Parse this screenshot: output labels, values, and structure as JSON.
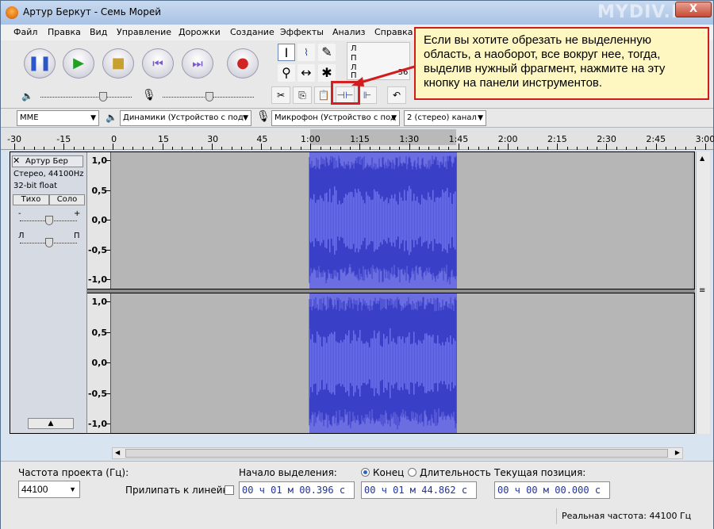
{
  "window": {
    "title": "Артур Беркут - Семь Морей",
    "watermark": "MYDIV.NET",
    "close_glyph": "X"
  },
  "menu": [
    "Файл",
    "Правка",
    "Вид",
    "Управление",
    "Дорожки",
    "Создание",
    "Эффекты",
    "Анализ",
    "Справка"
  ],
  "transport": {
    "pause": "pause-icon",
    "play": "play-icon",
    "stop": "stop-icon",
    "skip_start": "skip-start-icon",
    "skip_end": "skip-end-icon",
    "record": "record-icon"
  },
  "meters": {
    "left_label": "Л",
    "right_label": "П",
    "left_label_2": "Л",
    "right_label_2": "П",
    "db_value": "-36"
  },
  "callout": {
    "text": "Если вы хотите обрезать не выделенную область, а наоборот, все вокруг нее, тогда, выделив нужный фрагмент, нажмите на эту кнопку на панели инструментов."
  },
  "devices": {
    "host": "MME",
    "output": "Динамики (Устройство с под",
    "input": "Микрофон (Устройство с под",
    "channels": "2 (стерео) канал"
  },
  "ruler": {
    "labels": [
      "-30",
      "-15",
      "0",
      "15",
      "30",
      "45",
      "1:00",
      "1:15",
      "1:30",
      "1:45",
      "2:00",
      "2:15",
      "2:30",
      "2:45",
      "3:00"
    ]
  },
  "track": {
    "name": "Артур Бер",
    "info_rate": "Стерео, 44100Hz",
    "info_format": "32-bit float",
    "mute": "Тихо",
    "solo": "Соло",
    "gain_minus": "-",
    "gain_plus": "+",
    "pan_left": "Л",
    "pan_right": "П",
    "scale": [
      "1,0",
      "0,5",
      "0,0",
      "-0,5",
      "-1,0"
    ]
  },
  "bottom": {
    "rate_label": "Частота проекта (Гц):",
    "rate_value": "44100",
    "snap_label": "Прилипать к линейке",
    "sel_start_label": "Начало выделения:",
    "sel_start_value": "00 ч 01 м 00.396 с",
    "end_label": "Конец",
    "length_label": "Длительность",
    "sel_end_value": "00 ч 01 м 44.862 с",
    "pos_label": "Текущая позиция:",
    "pos_value": "00 ч 00 м 00.000 с",
    "status": "Реальная частота: 44100 Гц"
  },
  "colors": {
    "waveform": "#3a3fc7",
    "waveform_rms": "#6a70e6",
    "selection": "#6b6ee0",
    "callout_border": "#d21b1b"
  }
}
